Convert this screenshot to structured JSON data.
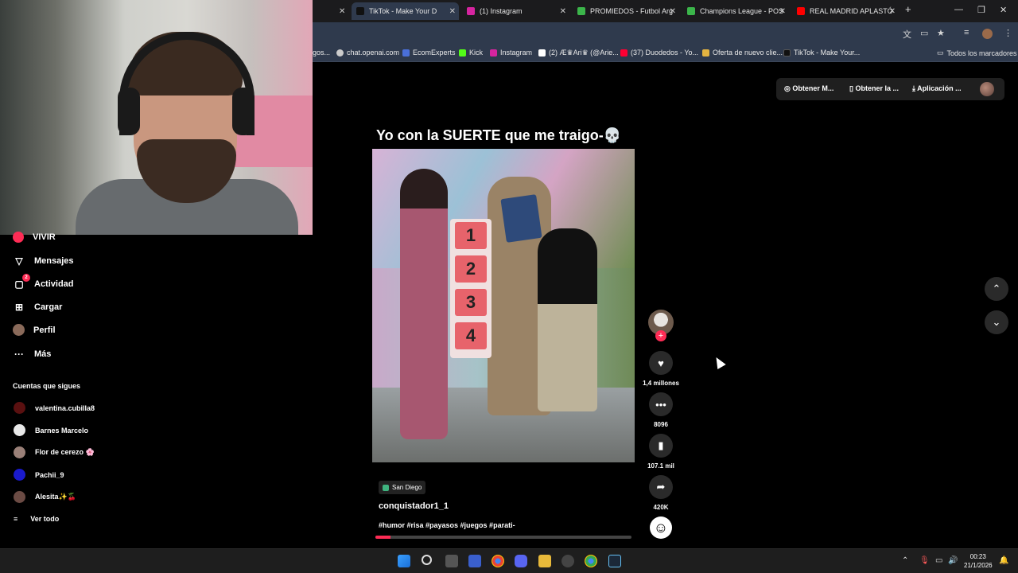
{
  "browser": {
    "tabs": [
      {
        "title": "TikTok - Make Your D",
        "active": true,
        "favicon_color": "#111111"
      },
      {
        "title": "(1) Instagram",
        "active": false,
        "favicon_color": "#d6249f"
      },
      {
        "title": "PROMIEDOS - Futbol Arg",
        "active": false,
        "favicon_color": "#3bb54a"
      },
      {
        "title": "Champions League - POS",
        "active": false,
        "favicon_color": "#3bb54a"
      },
      {
        "title": "REAL MADRID APLASTÓ",
        "active": false,
        "favicon_color": "#ff0000"
      }
    ],
    "new_tab": "+",
    "bookmarks": [
      {
        "label": "gos...",
        "color": "#888888"
      },
      {
        "label": "chat.openai.com",
        "color": "#cccccc"
      },
      {
        "label": "EcomExperts",
        "color": "#4a6fd8"
      },
      {
        "label": "Kick",
        "color": "#53fc18"
      },
      {
        "label": "Instagram",
        "color": "#d6249f"
      },
      {
        "label": "(2) Æ♛Ari♛ (@Arie...",
        "color": "#ffffff"
      },
      {
        "label": "(37) Duodedos - Yo...",
        "color": "#ff0033"
      },
      {
        "label": "Oferta de nuevo clie...",
        "color": "#e3b341"
      },
      {
        "label": "TikTok - Make Your...",
        "color": "#111111"
      }
    ],
    "all_bookmarks": "Todos los marcadores"
  },
  "sidebar": {
    "nav": [
      {
        "label": "VIVIR",
        "icon": "live-icon"
      },
      {
        "label": "Mensajes",
        "icon": "send-icon"
      },
      {
        "label": "Actividad",
        "icon": "activity-icon",
        "badge": "2"
      },
      {
        "label": "Cargar",
        "icon": "upload-icon"
      },
      {
        "label": "Perfil",
        "icon": "profile-avatar"
      },
      {
        "label": "Más",
        "icon": "more-icon"
      }
    ],
    "following_title": "Cuentas que sigues",
    "accounts": [
      {
        "name": "valentina.cubilla8",
        "color": "#5a1010"
      },
      {
        "name": "Barnes Marcelo",
        "color": "#e8e8e8"
      },
      {
        "name": "Flor de cerezo 🌸",
        "color": "#9a8078"
      },
      {
        "name": "Pachii_9",
        "color": "#1a1acc"
      },
      {
        "name": "Alesita✨🍒",
        "color": "#6b4b44"
      }
    ],
    "see_all": "Ver todo"
  },
  "topbar": {
    "btn1": "Obtener M...",
    "btn2": "Obtener la ...",
    "btn3": "Aplicación ..."
  },
  "video": {
    "caption": "Yo con la SUERTE que me traigo-💀",
    "sign_numbers": [
      "1",
      "2",
      "3",
      "4"
    ],
    "location": "San Diego",
    "author": "conquistador1_1",
    "hashtags": "#humor #risa #payasos #juegos #parati-",
    "progress": 0.06,
    "likes": "1,4 millones",
    "comments": "8096",
    "saves": "107.1 mil",
    "shares": "420K"
  },
  "taskbar": {
    "time": "00:23",
    "date": "21/1/2026"
  }
}
